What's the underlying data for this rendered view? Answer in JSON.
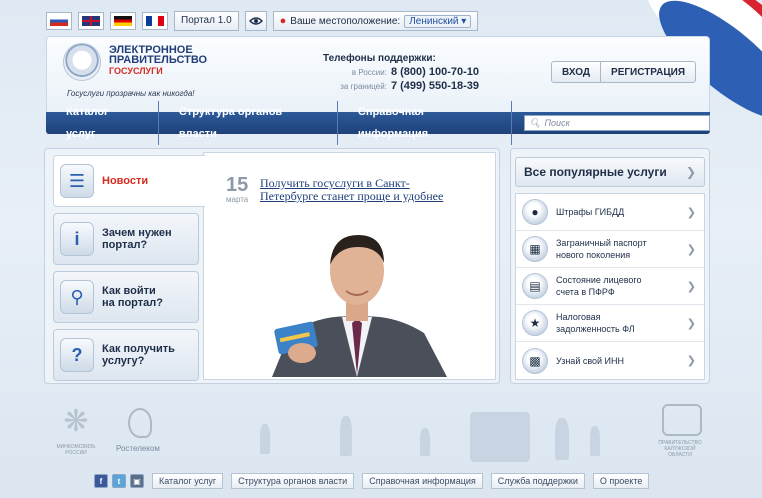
{
  "topbar": {
    "portal_label": "Портал 1.0",
    "location_label": "Ваше местоположение:",
    "location_value": "Ленинский"
  },
  "header": {
    "logo_line1": "ЭЛЕКТРОННОЕ",
    "logo_line2": "ПРАВИТЕЛЬСТВО",
    "logo_line3": "ГОСУСЛУГИ",
    "tagline": "Госуслуги прозрачны как никогда!",
    "phones_title": "Телефоны поддержки:",
    "phone_ru_label": "в России:",
    "phone_ru": "8 (800) 100-70-10",
    "phone_abroad_label": "за границей:",
    "phone_abroad": "7 (499) 550-18-39",
    "login": "ВХОД",
    "register": "РЕГИСТРАЦИЯ"
  },
  "nav": {
    "items": [
      "Каталог услуг",
      "Структура органов власти",
      "Справочная информация"
    ],
    "search_placeholder": "Поиск"
  },
  "tabs": [
    {
      "label": "Новости",
      "icon": "newspaper-icon"
    },
    {
      "label": "Зачем нужен\nпортал?",
      "icon": "info-icon"
    },
    {
      "label": "Как войти\nна портал?",
      "icon": "login-icon"
    },
    {
      "label": "Как получить\nуслугу?",
      "icon": "question-icon"
    }
  ],
  "news": {
    "day": "15",
    "month": "марта",
    "headline": "Получить госуслуги в Санкт-Петербурге станет проще и удобнее"
  },
  "popular": {
    "title": "Все популярные услуги",
    "items": [
      {
        "label": "Штрафы ГИБДД",
        "icon": "traffic-light-icon"
      },
      {
        "label": "Заграничный паспорт\nнового поколения",
        "icon": "passport-icon"
      },
      {
        "label": "Состояние лицевого\nсчета в ПФРФ",
        "icon": "pension-account-icon"
      },
      {
        "label": "Налоговая\nзадолженность ФЛ",
        "icon": "tax-emblem-icon"
      },
      {
        "label": "Узнай свой ИНН",
        "icon": "inn-document-icon"
      }
    ]
  },
  "footer": {
    "ministry": "Минкомсвязь России",
    "rostelecom": "Ростелеком",
    "kaluga": "Правительство Калужской области",
    "links": [
      "Каталог услуг",
      "Структура органов власти",
      "Справочная информация",
      "Служба поддержки",
      "О проекте"
    ]
  },
  "colors": {
    "nav_bg": "#2d5a99",
    "accent_red": "#d52b1e",
    "link_blue": "#1f3f7a"
  }
}
